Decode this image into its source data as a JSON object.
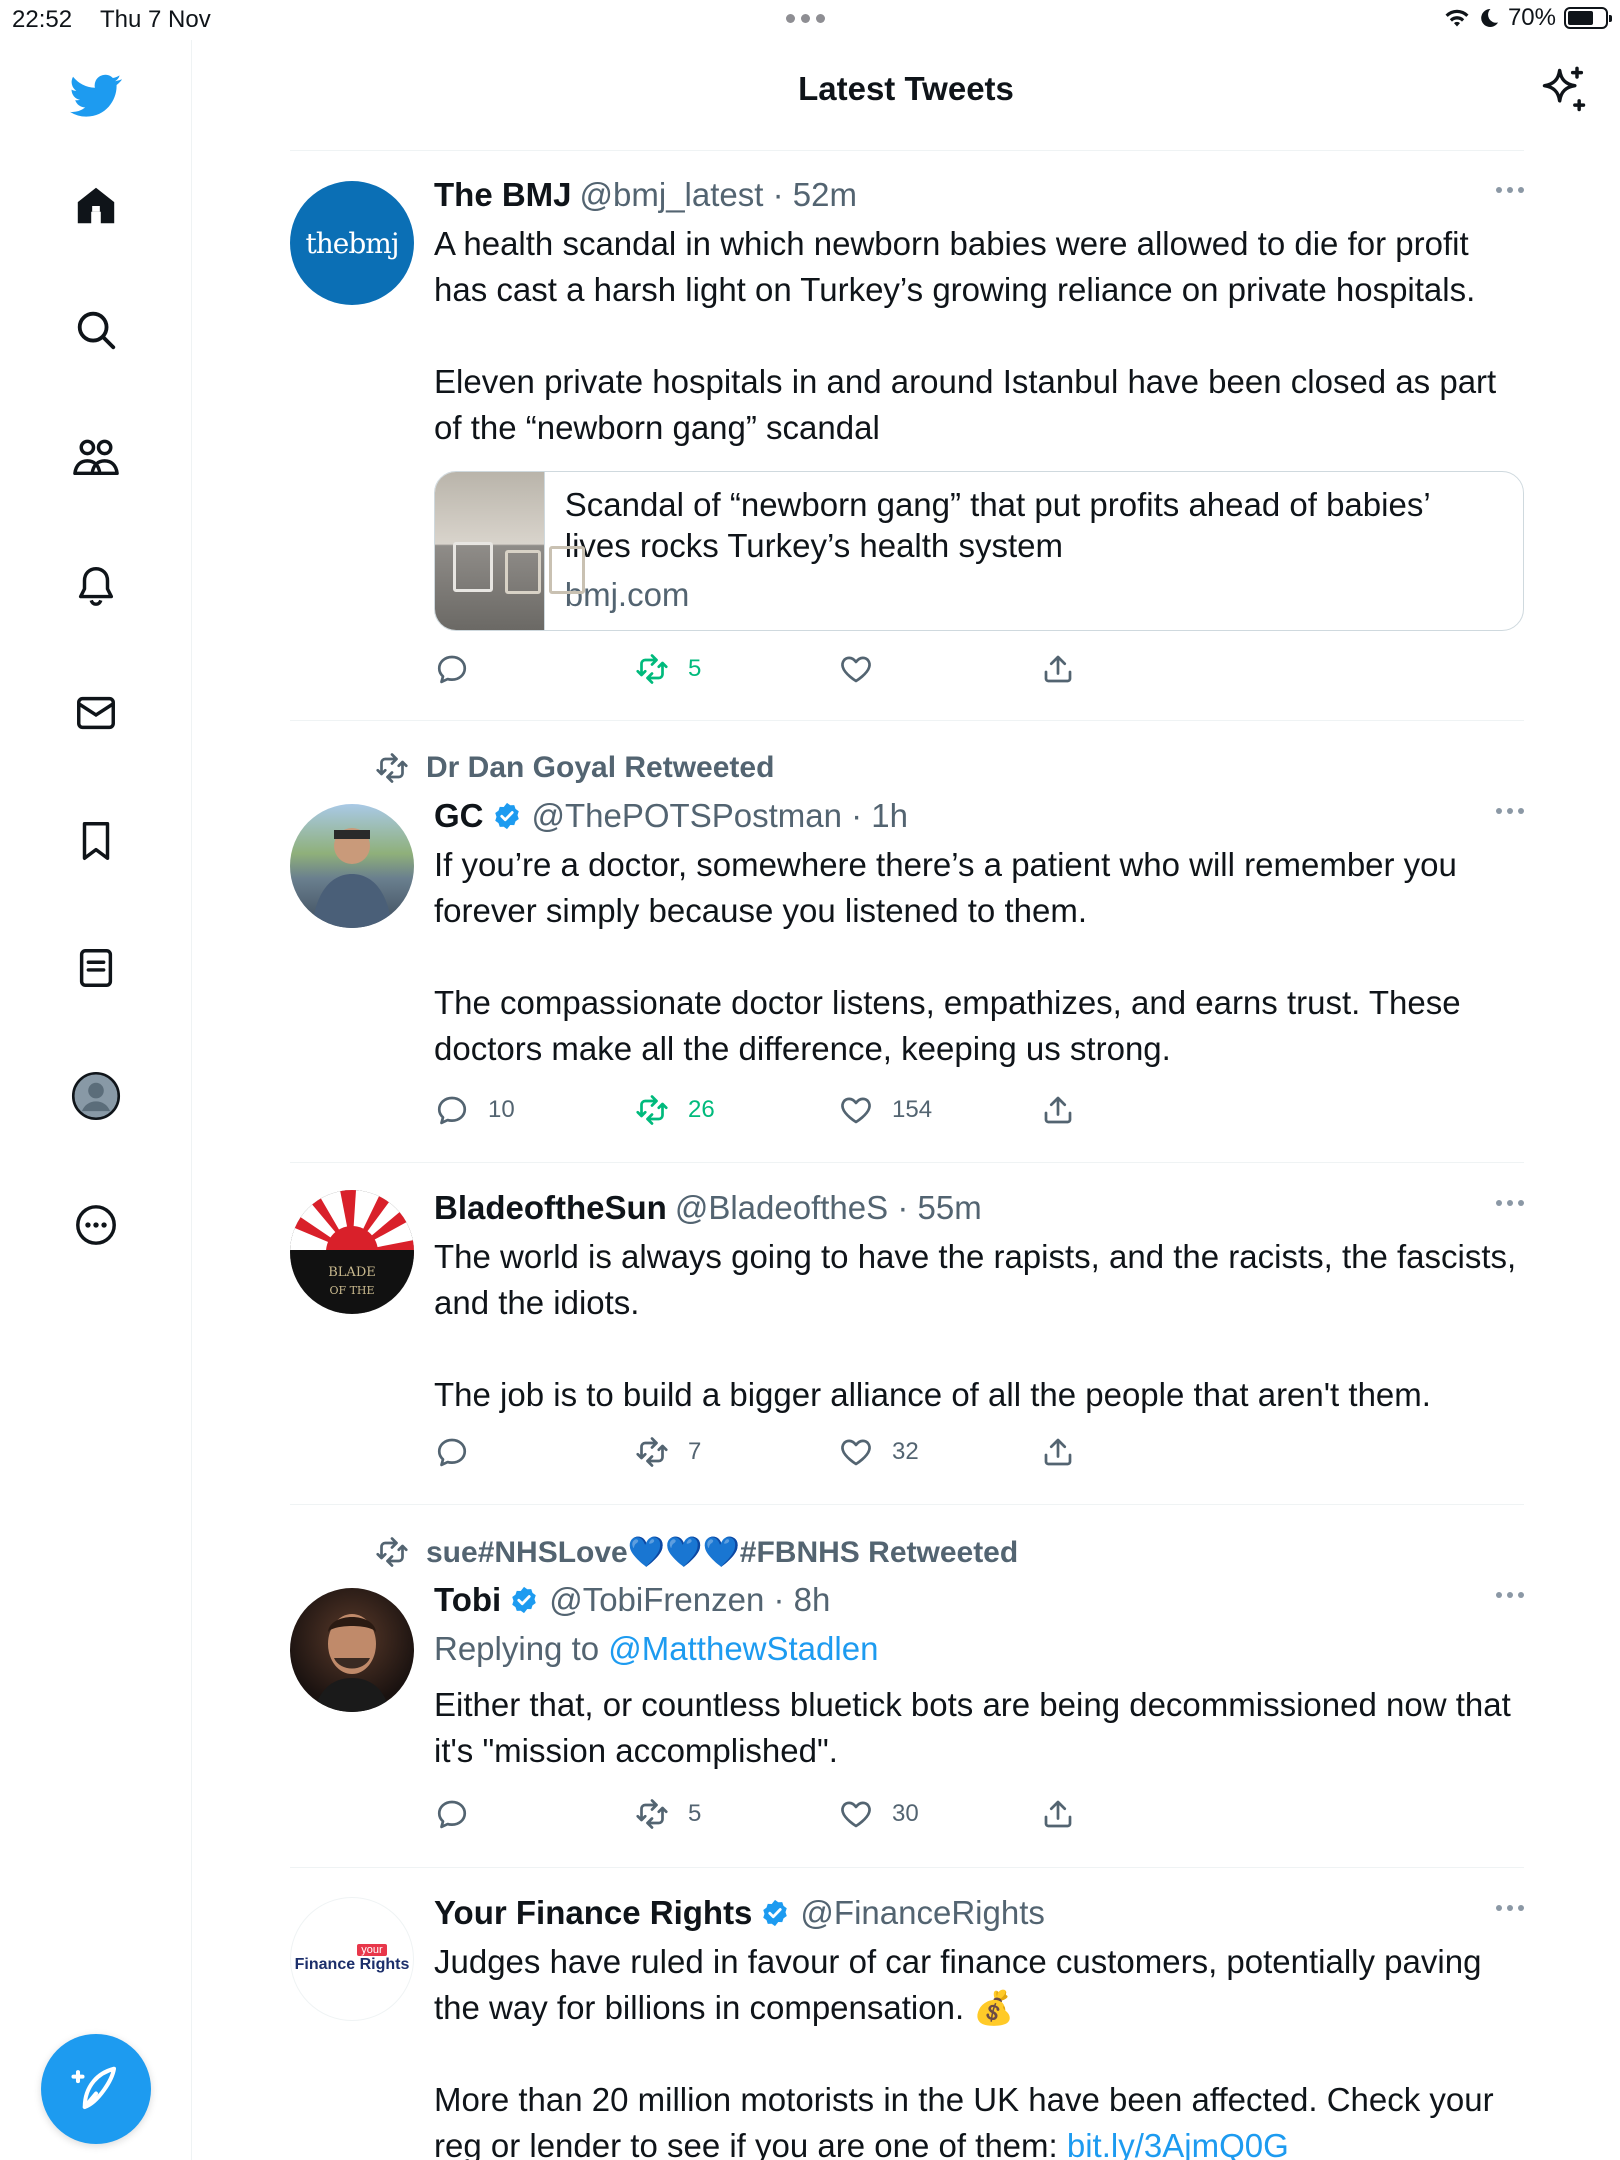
{
  "status_bar": {
    "time": "22:52",
    "date": "Thu 7 Nov",
    "battery": "70%",
    "battery_level": 0.7
  },
  "sidebar": {
    "icons": [
      "twitter-bird-icon",
      "home-icon",
      "search-icon",
      "communities-icon",
      "notifications-icon",
      "messages-icon",
      "bookmarks-icon",
      "lists-icon",
      "profile-icon",
      "more-icon"
    ],
    "compose_icon": "compose-icon"
  },
  "header": {
    "title": "Latest Tweets",
    "sparkle_icon": "sparkle-icon"
  },
  "colors": {
    "accent": "#1d9bf0",
    "retweet_green": "#00ba7c",
    "text": "#0f1419",
    "muted": "#536471"
  },
  "tweets": [
    {
      "name": "The BMJ",
      "handle": "@bmj_latest",
      "time": "52m",
      "avatar_text": "thebmj",
      "body": [
        "A health scandal in which newborn babies were allowed to die for profit has cast a harsh light on Turkey’s growing reliance on private hospitals.",
        "Eleven private hospitals in and around Istanbul have been closed as part of the “newborn gang” scandal"
      ],
      "card": {
        "title": "Scandal of “newborn gang” that put profits ahead of babies’ lives rocks Turkey’s health system",
        "domain": "bmj.com"
      },
      "replies": "",
      "retweets": "5",
      "likes": ""
    },
    {
      "retweeted_by": "Dr Dan Goyal Retweeted",
      "name": "GC",
      "handle": "@ThePOTSPostman",
      "time": "1h",
      "body": [
        "If you’re a doctor, somewhere there’s a patient who will remember you forever simply because you listened to them.",
        "The compassionate doctor listens, empathizes, and earns trust. These doctors make all the difference, keeping us strong."
      ],
      "replies": "10",
      "retweets": "26",
      "likes": "154"
    },
    {
      "name": "BladeoftheSun",
      "handle": "@BladeoftheS",
      "time": "55m",
      "avatar_text": "BLADE OF THE",
      "body": [
        "The world is always going to have the rapists, and the racists, the fascists, and the idiots.",
        "The job is to build a bigger alliance of all the people that aren't them."
      ],
      "replies": "",
      "retweets": "7",
      "likes": "32"
    },
    {
      "retweeted_by": "sue#NHSLove💙💙💙#FBNHS Retweeted",
      "name": "Tobi",
      "handle": "@TobiFrenzen",
      "time": "8h",
      "replying_label": "Replying to",
      "replying_to": "@MatthewStadlen",
      "body": [
        "Either that, or countless bluetick bots are being decommissioned now that it's \"mission accomplished\"."
      ],
      "replies": "",
      "retweets": "5",
      "likes": "30"
    },
    {
      "name": "Your Finance Rights",
      "handle": "@FinanceRights",
      "avatar_text": "Finance Rights",
      "avatar_tag": "your",
      "body_1": "Judges have ruled in favour of car finance customers, potentially paving the way for billions in compensation. 💰",
      "body_2": "More than 20 million motorists in the UK have been affected. Check your reg or lender to see if you are one of them:",
      "body_link": "bit.ly/3AjmQ0G"
    }
  ]
}
